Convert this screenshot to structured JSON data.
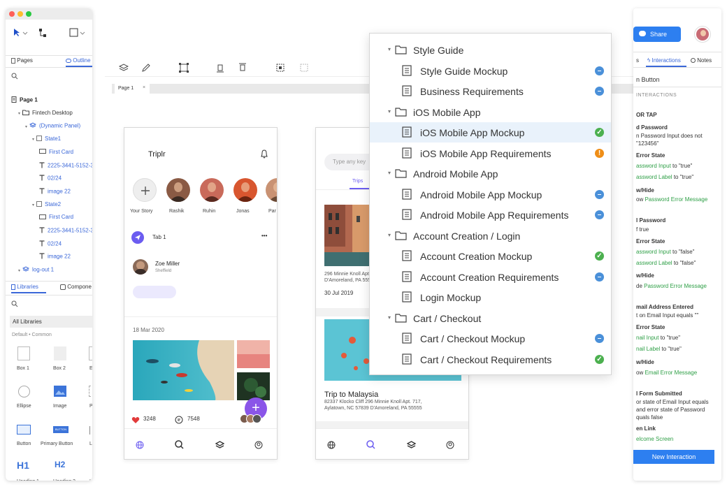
{
  "left_panel": {
    "tabs": {
      "pages": "Pages",
      "outline": "Outline"
    },
    "tree": [
      {
        "label": "Page 1",
        "indent": 0,
        "bold": true,
        "icon": "page-icon"
      },
      {
        "label": "Fintech Desktop",
        "indent": 1,
        "icon": "folder-icon"
      },
      {
        "label": "(Dynamic Panel)",
        "indent": 2,
        "icon": "layers-icon",
        "blue": true
      },
      {
        "label": "State1",
        "indent": 3,
        "icon": "state-icon",
        "blue": true
      },
      {
        "label": "First Card",
        "indent": 4,
        "icon": "rect-icon",
        "blue": true
      },
      {
        "label": "2225-3441-5152-3",
        "indent": 4,
        "icon": "text-icon",
        "blue": true
      },
      {
        "label": "02/24",
        "indent": 4,
        "icon": "text-icon",
        "blue": true
      },
      {
        "label": "image 22",
        "indent": 4,
        "icon": "text-icon",
        "blue": true
      },
      {
        "label": "State2",
        "indent": 3,
        "icon": "state-icon",
        "blue": true
      },
      {
        "label": "First Card",
        "indent": 4,
        "icon": "rect-icon",
        "blue": true
      },
      {
        "label": "2225-3441-5152-3",
        "indent": 4,
        "icon": "text-icon",
        "blue": true
      },
      {
        "label": "02/24",
        "indent": 4,
        "icon": "text-icon",
        "blue": true
      },
      {
        "label": "image 22",
        "indent": 4,
        "icon": "text-icon",
        "blue": true
      },
      {
        "label": "log-out 1",
        "indent": 1,
        "icon": "layers-icon",
        "blue": true
      }
    ],
    "lib_tabs": {
      "libraries": "Libraries",
      "components": "Compone"
    },
    "all_libraries": "All Libraries",
    "default_common": "Default • Common",
    "widgets": [
      [
        "Box 1",
        "Box 2",
        "E"
      ],
      [
        "Ellipse",
        "Image",
        "Plac"
      ],
      [
        "Button",
        "Primary Button",
        "Link"
      ],
      [
        "Heading 1",
        "Heading 2",
        "He"
      ]
    ],
    "h1": "H1",
    "h2": "H2",
    "primary_btn_text": "BUTTON"
  },
  "canvas": {
    "page_tab": "Page 1",
    "page_tab_close": "×"
  },
  "phone1": {
    "title": "Triplr",
    "stories": [
      "Your Story",
      "Rashik",
      "Ruhin",
      "Jonas",
      "Par"
    ],
    "tab_label": "Tab 1",
    "more": "•••",
    "user_name": "Zoe Miller",
    "user_location": "Sheffield",
    "date": "18 Mar 2020",
    "likes": "3248",
    "comments": "7548",
    "fab": "+"
  },
  "phone2": {
    "search_placeholder": "Type any key",
    "tab_trips": "Trips",
    "address1": "296 Minnie Knoll Apt. 717,",
    "address1b": "D'Amoreland, PA 55555",
    "date1": "30 Jul 2019",
    "trip_title": "Trip to Malaysia",
    "trip_addr1": "82337 Klocko Cliff 296 Minnie Knoll Apt. 717,",
    "trip_addr2": "Aylatown, NC 57839 D'Amoreland, PA 55555"
  },
  "dropdown": {
    "items": [
      {
        "label": "Style Guide",
        "type": "folder",
        "status": ""
      },
      {
        "label": "Style Guide Mockup",
        "type": "page",
        "status": "blue"
      },
      {
        "label": "Business Requirements",
        "type": "page",
        "status": "blue"
      },
      {
        "label": "iOS Mobile App",
        "type": "folder",
        "status": ""
      },
      {
        "label": "iOS Mobile App Mockup",
        "type": "page",
        "status": "green",
        "selected": true
      },
      {
        "label": "iOS Mobile App Requirements",
        "type": "page",
        "status": "orange"
      },
      {
        "label": "Android Mobile App",
        "type": "folder",
        "status": ""
      },
      {
        "label": "Android Mobile App Mockup",
        "type": "page",
        "status": "blue"
      },
      {
        "label": "Android Mobile App Requirements",
        "type": "page",
        "status": "blue"
      },
      {
        "label": "Account Creation / Login",
        "type": "folder",
        "status": ""
      },
      {
        "label": "Account Creation Mockup",
        "type": "page",
        "status": "green"
      },
      {
        "label": "Account Creation Requirements",
        "type": "page",
        "status": "blue"
      },
      {
        "label": "Login Mockup",
        "type": "page",
        "status": ""
      },
      {
        "label": "Cart / Checkout",
        "type": "folder",
        "status": ""
      },
      {
        "label": "Cart / Checkout Mockup",
        "type": "page",
        "status": "blue"
      },
      {
        "label": "Cart / Checkout Requirements",
        "type": "page",
        "status": "green"
      }
    ]
  },
  "right_panel": {
    "share": "Share",
    "tabs": {
      "interactions": "Interactions",
      "notes": "Notes"
    },
    "widget_name": "n Button",
    "section": "INTERACTIONS",
    "lines": [
      {
        "text": "OR TAP",
        "style": "head"
      },
      {
        "text": "d Password",
        "style": "head"
      },
      {
        "text": "n Password Input does not",
        "style": ""
      },
      {
        "text": "\"123456\"",
        "style": ""
      },
      {
        "text": "Error State",
        "style": "head"
      },
      {
        "text": "assword Input",
        "style": "green",
        "suffix": " to \"true\""
      },
      {
        "text": "assword Label",
        "style": "green",
        "suffix": " to \"true\""
      },
      {
        "text": "w/Hide",
        "style": "head"
      },
      {
        "text": "ow ",
        "style": "",
        "green_part": "Password Error Message"
      },
      {
        "text": "l Password",
        "style": "head"
      },
      {
        "text": "f true",
        "style": ""
      },
      {
        "text": "Error State",
        "style": "head"
      },
      {
        "text": "assword Input",
        "style": "green",
        "suffix": " to \"false\""
      },
      {
        "text": "assword Label",
        "style": "green",
        "suffix": " to \"false\""
      },
      {
        "text": "w/Hide",
        "style": "head"
      },
      {
        "text": "de ",
        "style": "",
        "green_part": "Password Error Message"
      },
      {
        "text": "mail Address Entered",
        "style": "head"
      },
      {
        "text": "t on Email Input equals \"\"",
        "style": ""
      },
      {
        "text": "Error State",
        "style": "head"
      },
      {
        "text": "nail Input",
        "style": "green",
        "suffix": " to \"true\""
      },
      {
        "text": "nail Label",
        "style": "green",
        "suffix": " to \"true\""
      },
      {
        "text": "w/Hide",
        "style": "head"
      },
      {
        "text": "ow ",
        "style": "",
        "green_part": "Email Error Message"
      },
      {
        "text": "l Form Submitted",
        "style": "head"
      },
      {
        "text": "or state of Email Input equals",
        "style": ""
      },
      {
        "text": "and error state of Password",
        "style": ""
      },
      {
        "text": "quals false",
        "style": ""
      },
      {
        "text": "en Link",
        "style": "head"
      },
      {
        "text": "elcome Screen",
        "style": "green"
      }
    ],
    "new_interaction": "New Interaction"
  }
}
